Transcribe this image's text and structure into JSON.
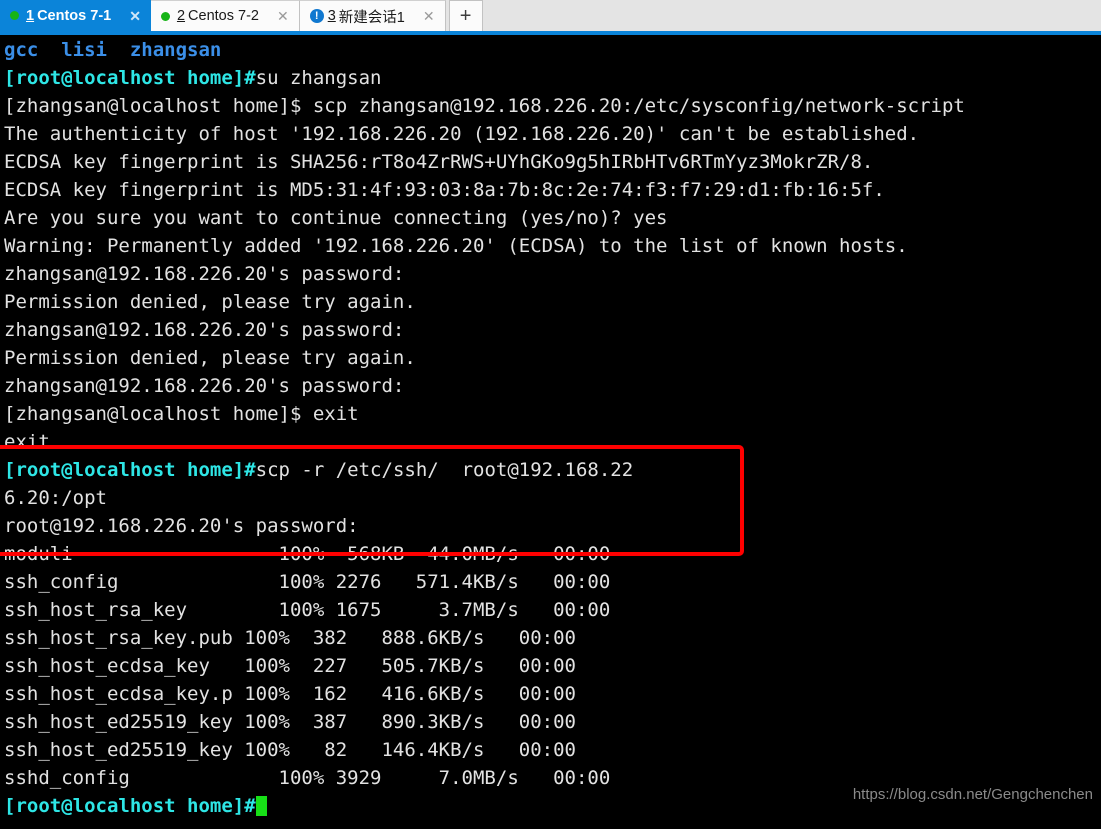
{
  "window": {
    "tabs": [
      {
        "num": "1",
        "label": "Centos 7-1",
        "status_icon": "green-dot",
        "close": "✕",
        "active": true
      },
      {
        "num": "2",
        "label": "Centos 7-2",
        "status_icon": "green-dot",
        "close": "✕",
        "active": false
      },
      {
        "num": "3",
        "label": "新建会话1",
        "status_icon": "warning-badge",
        "badge": "!",
        "close": "✕",
        "active": false
      }
    ],
    "new_tab_label": "+",
    "accent_color": "#0b84d9"
  },
  "terminal": {
    "background": "#000000",
    "foreground": "#e2e2e2",
    "prompt_color": "#2ee6e6",
    "listing_color": "#3b8fe8",
    "cursor_color": "#17e017",
    "lines": [
      {
        "id": "l01",
        "segments": [
          {
            "t": "gcc  lisi  zhangsan",
            "c": "c-blue"
          }
        ]
      },
      {
        "id": "l02",
        "segments": [
          {
            "t": "[root@localhost home]#",
            "c": "c-cyan"
          },
          {
            "t": "su zhangsan",
            "c": "c-white"
          }
        ]
      },
      {
        "id": "l03",
        "segments": [
          {
            "t": "[zhangsan@localhost home]$ scp zhangsan@192.168.226.20:/etc/sysconfig/network-script",
            "c": "c-white"
          }
        ]
      },
      {
        "id": "l04",
        "segments": [
          {
            "t": "The authenticity of host '192.168.226.20 (192.168.226.20)' can't be established.",
            "c": "c-white"
          }
        ]
      },
      {
        "id": "l05",
        "segments": [
          {
            "t": "ECDSA key fingerprint is SHA256:rT8o4ZrRWS+UYhGKo9g5hIRbHTv6RTmYyz3MokrZR/8.",
            "c": "c-white"
          }
        ]
      },
      {
        "id": "l06",
        "segments": [
          {
            "t": "ECDSA key fingerprint is MD5:31:4f:93:03:8a:7b:8c:2e:74:f3:f7:29:d1:fb:16:5f.",
            "c": "c-white"
          }
        ]
      },
      {
        "id": "l07",
        "segments": [
          {
            "t": "Are you sure you want to continue connecting (yes/no)? yes",
            "c": "c-white"
          }
        ]
      },
      {
        "id": "l08",
        "segments": [
          {
            "t": "Warning: Permanently added '192.168.226.20' (ECDSA) to the list of known hosts.",
            "c": "c-white"
          }
        ]
      },
      {
        "id": "l09",
        "segments": [
          {
            "t": "zhangsan@192.168.226.20's password:",
            "c": "c-white"
          }
        ]
      },
      {
        "id": "l10",
        "segments": [
          {
            "t": "Permission denied, please try again.",
            "c": "c-white"
          }
        ]
      },
      {
        "id": "l11",
        "segments": [
          {
            "t": "zhangsan@192.168.226.20's password:",
            "c": "c-white"
          }
        ]
      },
      {
        "id": "l12",
        "segments": [
          {
            "t": "Permission denied, please try again.",
            "c": "c-white"
          }
        ]
      },
      {
        "id": "l13",
        "segments": [
          {
            "t": "zhangsan@192.168.226.20's password:",
            "c": "c-white"
          }
        ]
      },
      {
        "id": "l14",
        "segments": [
          {
            "t": "[zhangsan@localhost home]$ exit",
            "c": "c-white"
          }
        ]
      },
      {
        "id": "l15",
        "segments": [
          {
            "t": "exit",
            "c": "c-white"
          }
        ]
      },
      {
        "id": "l16",
        "segments": [
          {
            "t": "[root@localhost home]#",
            "c": "c-cyan"
          },
          {
            "t": "scp -r /etc/ssh/  root@192.168.22",
            "c": "c-white"
          }
        ]
      },
      {
        "id": "l17",
        "segments": [
          {
            "t": "6.20:/opt",
            "c": "c-white"
          }
        ]
      },
      {
        "id": "l18",
        "segments": [
          {
            "t": "root@192.168.226.20's password:",
            "c": "c-white"
          }
        ]
      },
      {
        "id": "l19",
        "segments": [
          {
            "t": "moduli                  100%  568KB  44.0MB/s   00:00",
            "c": "c-white"
          }
        ]
      },
      {
        "id": "l20",
        "segments": [
          {
            "t": "ssh_config              100% 2276   571.4KB/s   00:00",
            "c": "c-white"
          }
        ]
      },
      {
        "id": "l21",
        "segments": [
          {
            "t": "ssh_host_rsa_key        100% 1675     3.7MB/s   00:00",
            "c": "c-white"
          }
        ]
      },
      {
        "id": "l22",
        "segments": [
          {
            "t": "ssh_host_rsa_key.pub 100%  382   888.6KB/s   00:00",
            "c": "c-white"
          }
        ]
      },
      {
        "id": "l23",
        "segments": [
          {
            "t": "ssh_host_ecdsa_key   100%  227   505.7KB/s   00:00",
            "c": "c-white"
          }
        ]
      },
      {
        "id": "l24",
        "segments": [
          {
            "t": "ssh_host_ecdsa_key.p 100%  162   416.6KB/s   00:00",
            "c": "c-white"
          }
        ]
      },
      {
        "id": "l25",
        "segments": [
          {
            "t": "ssh_host_ed25519_key 100%  387   890.3KB/s   00:00",
            "c": "c-white"
          }
        ]
      },
      {
        "id": "l26",
        "segments": [
          {
            "t": "ssh_host_ed25519_key 100%   82   146.4KB/s   00:00",
            "c": "c-white"
          }
        ]
      },
      {
        "id": "l27",
        "segments": [
          {
            "t": "sshd_config             100% 3929     7.0MB/s   00:00",
            "c": "c-white"
          }
        ]
      },
      {
        "id": "l28",
        "segments": [
          {
            "t": "[root@localhost home]#",
            "c": "c-cyan"
          }
        ],
        "cursor": true
      }
    ],
    "transfers": {
      "columns": [
        "file",
        "percent",
        "size",
        "rate",
        "time"
      ],
      "rows": [
        [
          "moduli",
          "100%",
          "568KB",
          "44.0MB/s",
          "00:00"
        ],
        [
          "ssh_config",
          "100%",
          "2276",
          "571.4KB/s",
          "00:00"
        ],
        [
          "ssh_host_rsa_key",
          "100%",
          "1675",
          "3.7MB/s",
          "00:00"
        ],
        [
          "ssh_host_rsa_key.pub",
          "100%",
          "382",
          "888.6KB/s",
          "00:00"
        ],
        [
          "ssh_host_ecdsa_key",
          "100%",
          "227",
          "505.7KB/s",
          "00:00"
        ],
        [
          "ssh_host_ecdsa_key.p",
          "100%",
          "162",
          "416.6KB/s",
          "00:00"
        ],
        [
          "ssh_host_ed25519_key",
          "100%",
          "387",
          "890.3KB/s",
          "00:00"
        ],
        [
          "ssh_host_ed25519_key",
          "100%",
          "82",
          "146.4KB/s",
          "00:00"
        ],
        [
          "sshd_config",
          "100%",
          "3929",
          "7.0MB/s",
          "00:00"
        ]
      ]
    }
  },
  "annotation": {
    "color": "#ff0000",
    "highlights_lines": [
      "l14",
      "l15",
      "l16",
      "l17"
    ]
  },
  "watermark": {
    "text": "https://blog.csdn.net/Gengchenchen"
  }
}
